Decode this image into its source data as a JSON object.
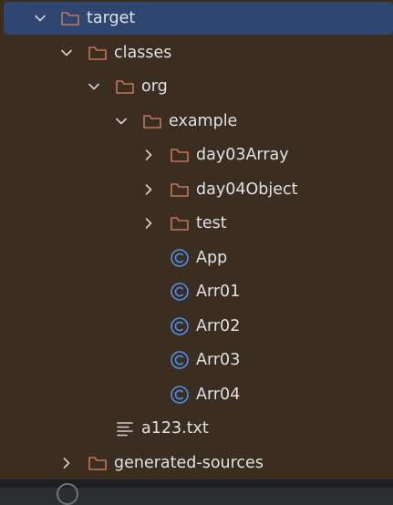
{
  "colors": {
    "tree_background": "#3b2d1f",
    "selected_row": "#2f4671",
    "folder_icon": "#c2765a",
    "class_icon": "#4d8ff0",
    "chevron": "#cfd2d6",
    "text": "#dfe1e5"
  },
  "project_tree": {
    "items": [
      {
        "label": "target",
        "icon": "folder-icon",
        "expanded": true,
        "selected": true
      },
      {
        "label": "classes",
        "icon": "folder-icon",
        "expanded": true
      },
      {
        "label": "org",
        "icon": "folder-icon",
        "expanded": true
      },
      {
        "label": "example",
        "icon": "folder-icon",
        "expanded": true
      },
      {
        "label": "day03Array",
        "icon": "folder-icon",
        "expanded": false
      },
      {
        "label": "day04Object",
        "icon": "folder-icon",
        "expanded": false
      },
      {
        "label": "test",
        "icon": "folder-icon",
        "expanded": false
      },
      {
        "label": "App",
        "icon": "java-class-icon"
      },
      {
        "label": "Arr01",
        "icon": "java-class-icon"
      },
      {
        "label": "Arr02",
        "icon": "java-class-icon"
      },
      {
        "label": "Arr03",
        "icon": "java-class-icon"
      },
      {
        "label": "Arr04",
        "icon": "java-class-icon"
      },
      {
        "label": "a123.txt",
        "icon": "text-file-icon"
      },
      {
        "label": "generated-sources",
        "icon": "folder-icon",
        "expanded": false
      }
    ]
  }
}
